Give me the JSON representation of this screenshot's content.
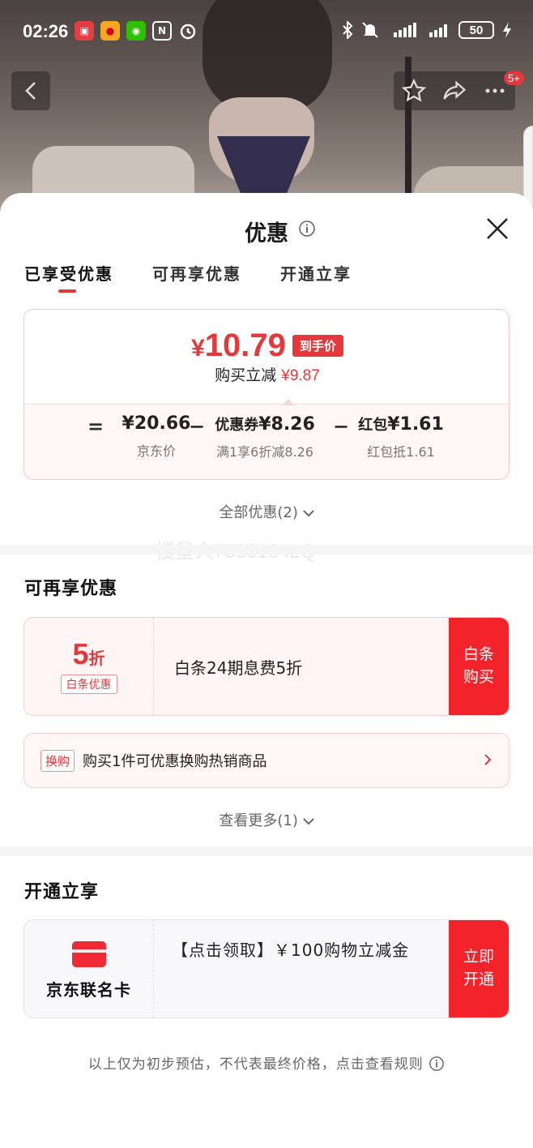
{
  "status_bar": {
    "time": "02:26",
    "battery": "50"
  },
  "nav": {
    "badge": "5+"
  },
  "sheet": {
    "title": "优惠",
    "tabs": [
      {
        "label": "已享受优惠",
        "active": true
      },
      {
        "label": "可再享优惠",
        "active": false
      },
      {
        "label": "开通立享",
        "active": false
      }
    ],
    "price_card": {
      "currency": "¥",
      "final_price": "10.79",
      "final_tag": "到手价",
      "reduce_label": "购买立减",
      "reduce_amount": "¥9.87",
      "equals": "=",
      "minus": "−",
      "jd_price": "¥20.66",
      "jd_price_label": "京东价",
      "coupon_label": "优惠券",
      "coupon_amount": "¥8.26",
      "coupon_desc": "满1享6折减8.26",
      "redpacket_label": "红包",
      "redpacket_amount": "¥1.61",
      "redpacket_desc": "红包抵1.61"
    },
    "all_promos": "全部优惠(2)",
    "watermark": "慢星人7535134LQ"
  },
  "more_promos": {
    "title": "可再享优惠",
    "baitiao": {
      "discount_num": "5",
      "discount_unit": "折",
      "tag": "白条优惠",
      "desc": "白条24期息费5折",
      "button": "白条购买"
    },
    "exchange": {
      "tag": "换购",
      "desc": "购买1件可优惠换购热销商品"
    },
    "see_more": "查看更多(1)"
  },
  "open_now": {
    "title": "开通立享",
    "card_label": "京东联名卡",
    "desc": "【点击领取】￥100购物立减金",
    "button": "立即开通"
  },
  "footnote": "以上仅为初步预估，不代表最终价格，点击查看规则",
  "colors": {
    "accent": "#e4393c",
    "button_red": "#f2232b"
  }
}
